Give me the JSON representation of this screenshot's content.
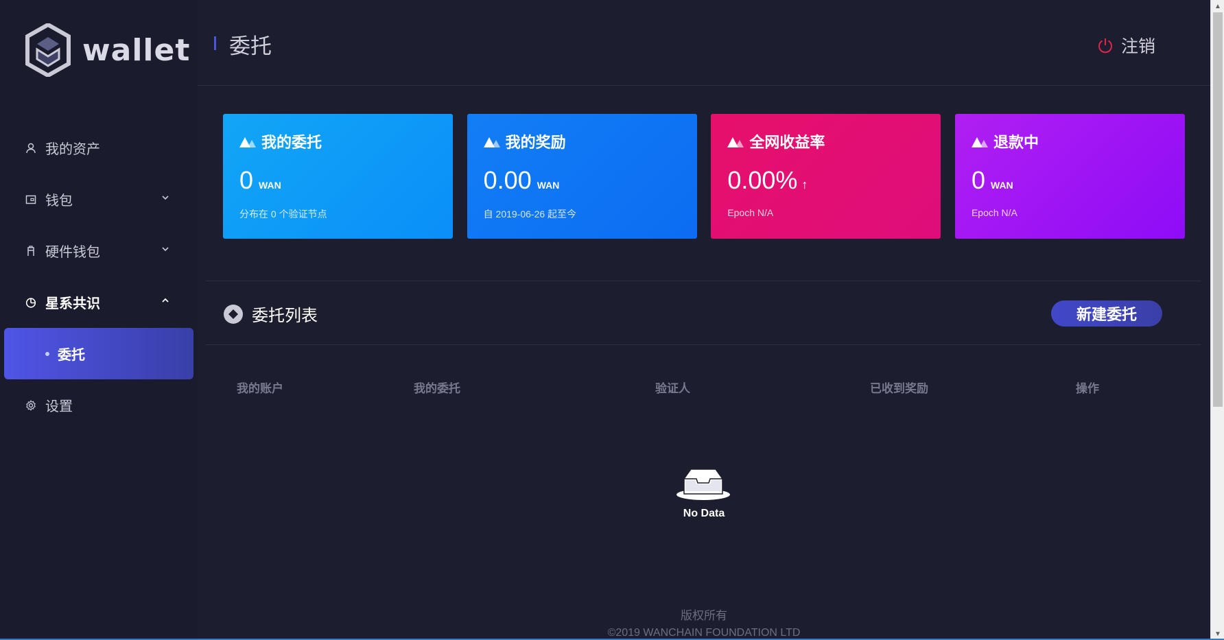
{
  "brand": {
    "logo_text": "wallet"
  },
  "sidebar": {
    "items": [
      {
        "label": "我的资产",
        "icon": "user-icon"
      },
      {
        "label": "钱包",
        "icon": "wallet-icon"
      },
      {
        "label": "硬件钱包",
        "icon": "hardware-wallet-icon"
      },
      {
        "label": "星系共识",
        "icon": "pie-chart-icon"
      },
      {
        "label": "设置",
        "icon": "gear-icon"
      }
    ],
    "submenu_active": "委托"
  },
  "header": {
    "title": "委托",
    "logout_label": "注销"
  },
  "cards": [
    {
      "title": "我的委托",
      "value": "0",
      "unit": "WAN",
      "sub": "分布在 0 个验证节点"
    },
    {
      "title": "我的奖励",
      "value": "0.00",
      "unit": "WAN",
      "sub": "自 2019-06-26 起至今"
    },
    {
      "title": "全网收益率",
      "value": "0.00%",
      "arrow": "↑",
      "sub": "Epoch N/A"
    },
    {
      "title": "退款中",
      "value": "0",
      "unit": "WAN",
      "sub": "Epoch N/A"
    }
  ],
  "delegation_list": {
    "title": "委托列表",
    "new_button": "新建委托",
    "columns": [
      "我的账户",
      "我的委托",
      "验证人",
      "已收到奖励",
      "操作"
    ],
    "empty_text": "No Data"
  },
  "footer": {
    "line1": "版权所有",
    "line2": "©2019 WANCHAIN FOUNDATION LTD"
  },
  "colors": {
    "background": "#1c1d2e",
    "sidebar": "#1a1b2c",
    "active_gradient": "#4f55e6",
    "card1": "#12a6f6",
    "card2": "#127ef5",
    "card3": "#e6106b",
    "card4": "#b01ff2",
    "logout_icon": "#e0254a"
  }
}
